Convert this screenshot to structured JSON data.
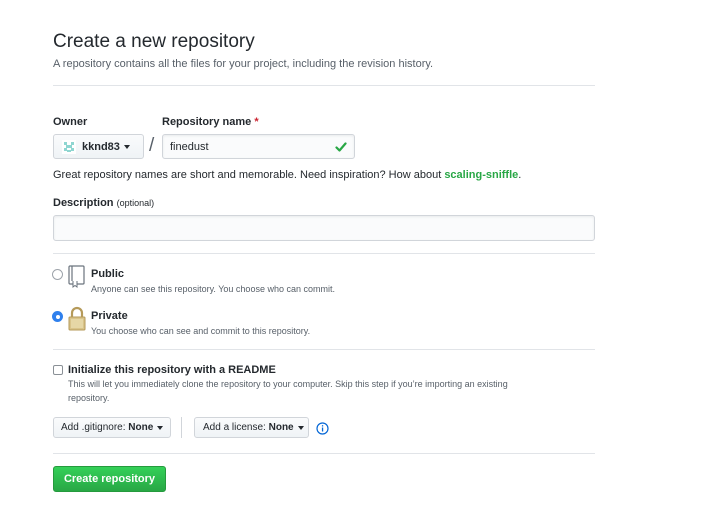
{
  "header": {
    "title": "Create a new repository",
    "subtitle": "A repository contains all the files for your project, including the revision history."
  },
  "owner": {
    "label": "Owner",
    "value": "kknd83"
  },
  "repo_name": {
    "label": "Repository name",
    "required_marker": "*",
    "value": "finedust",
    "separator": "/"
  },
  "hint": {
    "text": "Great repository names are short and memorable. Need inspiration? How about ",
    "suggestion": "scaling-sniffle",
    "end": "."
  },
  "description": {
    "label": "Description",
    "optional": "(optional)",
    "value": "",
    "placeholder": ""
  },
  "visibility": {
    "selected": "private",
    "public": {
      "label": "Public",
      "desc": "Anyone can see this repository. You choose who can commit."
    },
    "private": {
      "label": "Private",
      "desc": "You choose who can see and commit to this repository."
    }
  },
  "readme": {
    "checked": false,
    "label": "Initialize this repository with a README",
    "desc_line1": "This will let you immediately clone the repository to your computer. Skip this step if you’re importing an existing",
    "desc_line2": "repository."
  },
  "gitignore": {
    "label": "Add .gitignore:",
    "value": "None"
  },
  "license": {
    "label": "Add a license:",
    "value": "None"
  },
  "submit": {
    "label": "Create repository"
  },
  "colors": {
    "accent_green": "#28a745",
    "radio_blue": "#2f80ed",
    "required_red": "#cb2431",
    "info_blue": "#0366d6"
  }
}
